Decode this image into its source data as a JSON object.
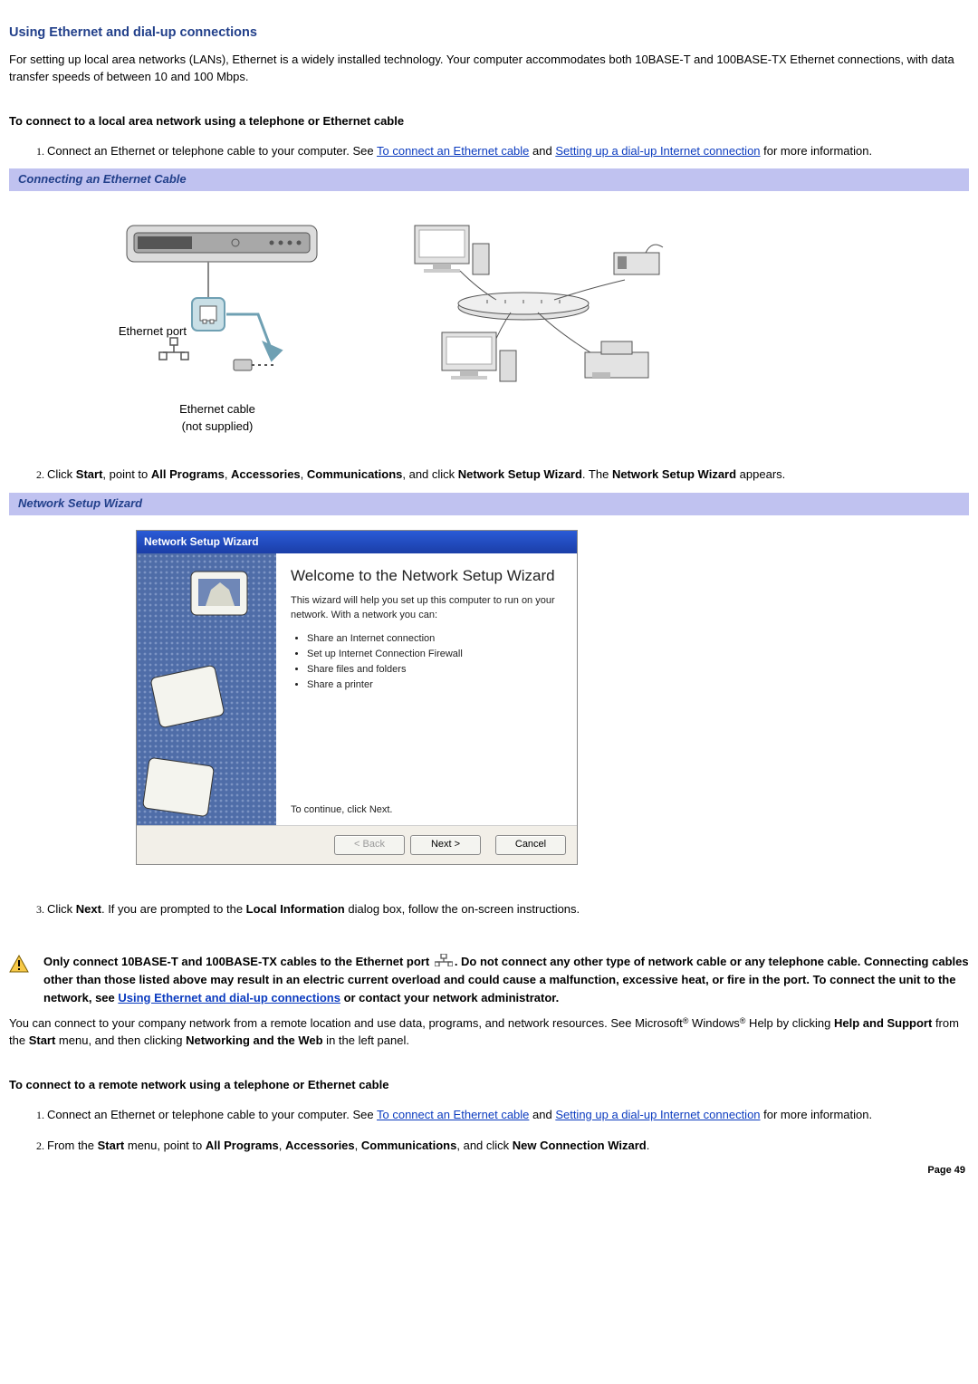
{
  "title": "Using Ethernet and dial-up connections",
  "intro": "For setting up local area networks (LANs), Ethernet is a widely installed technology. Your computer accommodates both 10BASE-T and 100BASE-TX Ethernet connections, with data transfer speeds of between 10 and 100 Mbps.",
  "sub1": "To connect to a local area network using a telephone or Ethernet cable",
  "step1_pre": "Connect an Ethernet or telephone cable to your computer. See ",
  "link_eth": "To connect an Ethernet cable",
  "step1_and": " and ",
  "link_dial": "Setting up a dial-up Internet connection",
  "step1_post": " for more information.",
  "fig1_caption": "Connecting an Ethernet Cable",
  "fig1_port_label": "Ethernet port",
  "fig1_cable_label": "Ethernet cable",
  "fig1_notsupplied": "(not supplied)",
  "step2_a": "Click ",
  "step2_b": "Start",
  "step2_c": ", point to ",
  "step2_d": "All Programs",
  "step2_e": ", ",
  "step2_f": "Accessories",
  "step2_g": ", ",
  "step2_h": "Communications",
  "step2_i": ", and click ",
  "step2_j": "Network Setup Wizard",
  "step2_k": ". The ",
  "step2_l": "Network Setup Wizard",
  "step2_m": " appears.",
  "fig2_caption": "Network Setup Wizard",
  "wizard": {
    "title": "Network Setup Wizard",
    "heading": "Welcome to the Network Setup Wizard",
    "para": "This wizard will help you set up this computer to run on your network. With a network you can:",
    "bullets": [
      "Share an Internet connection",
      "Set up Internet Connection Firewall",
      "Share files and folders",
      "Share a printer"
    ],
    "continue": "To continue, click Next.",
    "btn_back": "< Back",
    "btn_next": "Next >",
    "btn_cancel": "Cancel"
  },
  "step3_a": "Click ",
  "step3_b": "Next",
  "step3_c": ". If you are prompted to the ",
  "step3_d": "Local Information",
  "step3_e": " dialog box, follow the on-screen instructions.",
  "warning_a": "Only connect 10BASE-T and 100BASE-TX cables to the Ethernet port ",
  "warning_b": ". Do not connect any other type of network cable or any telephone cable. Connecting cables other than those listed above may result in an electric current overload and could cause a malfunction, excessive heat, or fire in the port. To connect the unit to the network, see ",
  "warning_link": "Using Ethernet and dial-up connections",
  "warning_c": " or contact your network administrator.",
  "remote_para_a": "You can connect to your company network from a remote location and use data, programs, and network resources. See Microsoft",
  "remote_para_b": " Windows",
  "remote_para_c": " Help by clicking ",
  "remote_para_d": "Help and Support",
  "remote_para_e": " from the ",
  "remote_para_f": "Start",
  "remote_para_g": " menu, and then clicking ",
  "remote_para_h": "Networking and the Web",
  "remote_para_i": " in the left panel.",
  "sub2": "To connect to a remote network using a telephone or Ethernet cable",
  "r_step1_pre": "Connect an Ethernet or telephone cable to your computer. See ",
  "r_step1_post": " for more information.",
  "r_step2_a": "From the ",
  "r_step2_b": "Start",
  "r_step2_c": " menu, point to ",
  "r_step2_d": "All Programs",
  "r_step2_e": ", ",
  "r_step2_f": "Accessories",
  "r_step2_g": ", ",
  "r_step2_h": "Communications",
  "r_step2_i": ", and click ",
  "r_step2_j": "New Connection Wizard",
  "r_step2_k": ".",
  "page_num": "Page 49"
}
